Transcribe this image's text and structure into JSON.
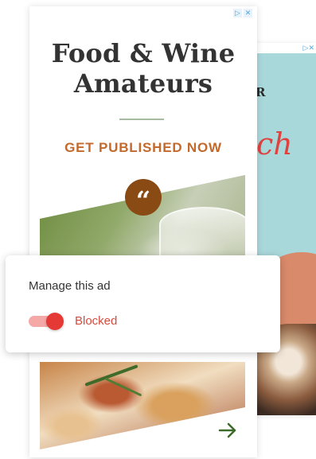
{
  "back_ad": {
    "letter": "R",
    "script_text": "ch",
    "adchoices_icons": [
      "play-triangle-icon",
      "close-x-icon"
    ],
    "adchoices_glyph": "▷✕"
  },
  "front_ad": {
    "adchoices_icons": [
      "play-triangle-icon",
      "close-x-icon"
    ],
    "adchoices_play": "▷",
    "adchoices_close": "✕",
    "title_line1": "Food & Wine",
    "title_line2": "Amateurs",
    "cta": "GET PUBLISHED NOW",
    "quote_glyph": "“",
    "arrow_icon": "arrow-right-icon"
  },
  "manage_popup": {
    "title": "Manage this ad",
    "toggle_label": "Blocked",
    "toggle_on": true
  },
  "colors": {
    "title": "#333333",
    "cta": "#c2692b",
    "quote_badge": "#8a4a14",
    "toggle_knob": "#e53935",
    "toggle_track": "#f4a8a8",
    "toggle_label": "#d64b3e",
    "arrow": "#3d6b2a",
    "back_teal": "#a9d8db"
  }
}
